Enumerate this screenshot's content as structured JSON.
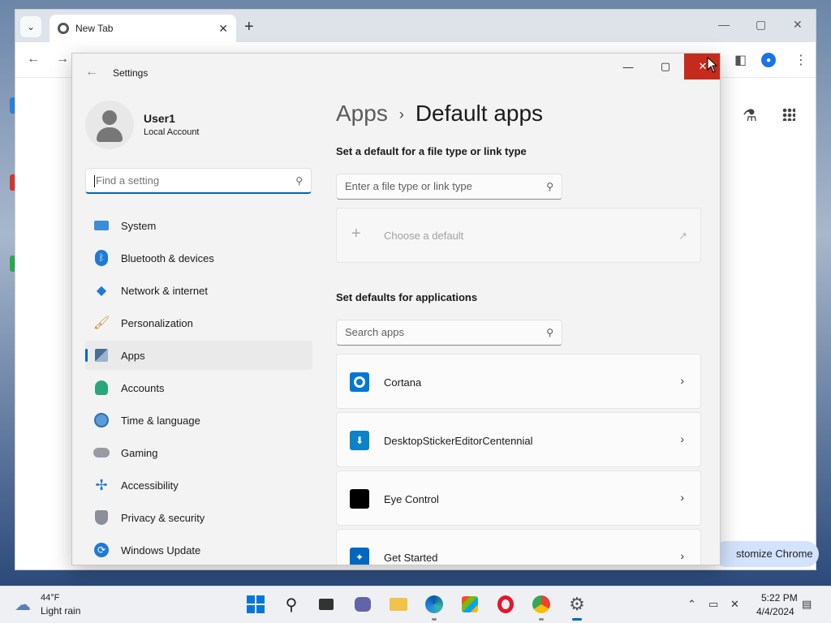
{
  "chrome": {
    "tab_title": "New Tab",
    "customize_label": "stomize Chrome"
  },
  "settings": {
    "window_title": "Settings",
    "user": {
      "name": "User1",
      "account_type": "Local Account"
    },
    "find_placeholder": "Find a setting",
    "nav": [
      {
        "label": "System",
        "icon": "system-icon",
        "active": false
      },
      {
        "label": "Bluetooth & devices",
        "icon": "bluetooth-icon",
        "active": false
      },
      {
        "label": "Network & internet",
        "icon": "wifi-icon",
        "active": false
      },
      {
        "label": "Personalization",
        "icon": "brush-icon",
        "active": false
      },
      {
        "label": "Apps",
        "icon": "apps-icon",
        "active": true
      },
      {
        "label": "Accounts",
        "icon": "accounts-icon",
        "active": false
      },
      {
        "label": "Time & language",
        "icon": "clock-globe-icon",
        "active": false
      },
      {
        "label": "Gaming",
        "icon": "gamepad-icon",
        "active": false
      },
      {
        "label": "Accessibility",
        "icon": "accessibility-icon",
        "active": false
      },
      {
        "label": "Privacy & security",
        "icon": "shield-icon",
        "active": false
      },
      {
        "label": "Windows Update",
        "icon": "update-icon",
        "active": false
      }
    ],
    "breadcrumb": {
      "parent": "Apps",
      "current": "Default apps"
    },
    "file_type_section": {
      "heading": "Set a default for a file type or link type",
      "placeholder": "Enter a file type or link type",
      "choose_label": "Choose a default"
    },
    "apps_section": {
      "heading": "Set defaults for applications",
      "search_placeholder": "Search apps",
      "apps": [
        {
          "name": "Cortana",
          "icon": "cortana-icon",
          "color": "#0078d4"
        },
        {
          "name": "DesktopStickerEditorCentennial",
          "icon": "sticker-editor-icon",
          "color": "#0a84c6"
        },
        {
          "name": "Eye Control",
          "icon": "eye-control-icon",
          "color": "#000000"
        },
        {
          "name": "Get Started",
          "icon": "get-started-icon",
          "color": "#0067c0"
        }
      ]
    }
  },
  "taskbar": {
    "weather": {
      "temp": "44°F",
      "desc": "Light rain"
    },
    "clock": {
      "time": "5:22 PM",
      "date": "4/4/2024"
    }
  },
  "colors": {
    "accent": "#0067c0",
    "close_red": "#c42b1c"
  }
}
